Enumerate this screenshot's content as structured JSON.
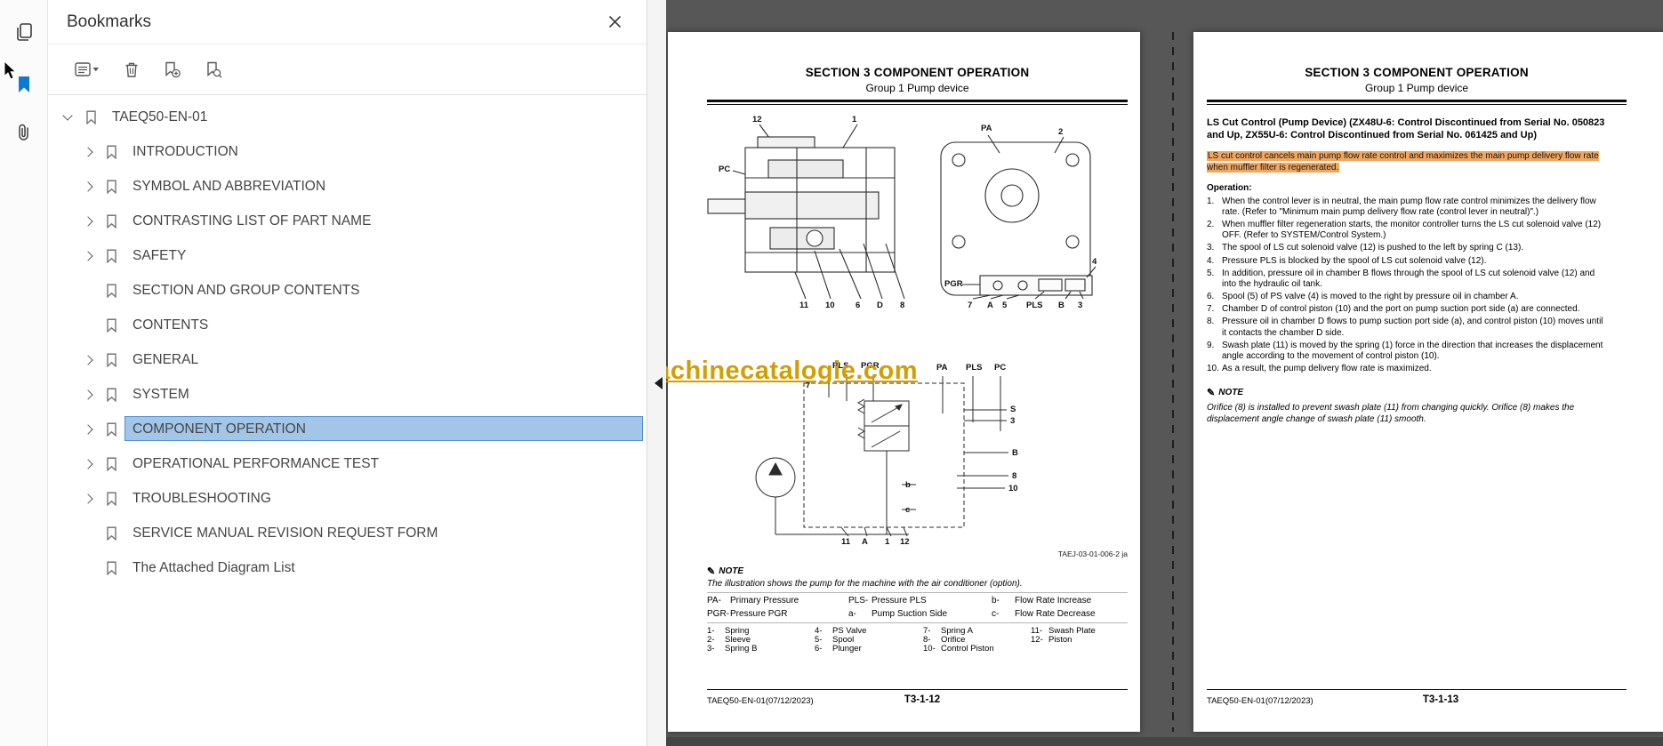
{
  "bookmarks": {
    "title": "Bookmarks",
    "tree": [
      {
        "label": "TAEQ50-EN-01"
      },
      {
        "label": "INTRODUCTION"
      },
      {
        "label": "SYMBOL AND ABBREVIATION"
      },
      {
        "label": "CONTRASTING LIST OF PART NAME"
      },
      {
        "label": "SAFETY"
      },
      {
        "label": "SECTION AND GROUP CONTENTS"
      },
      {
        "label": "CONTENTS"
      },
      {
        "label": "GENERAL"
      },
      {
        "label": "SYSTEM"
      },
      {
        "label": "COMPONENT OPERATION"
      },
      {
        "label": "OPERATIONAL PERFORMANCE TEST"
      },
      {
        "label": "TROUBLESHOOTING"
      },
      {
        "label": "SERVICE MANUAL REVISION REQUEST FORM"
      },
      {
        "label": "The Attached Diagram List"
      }
    ]
  },
  "page_header": {
    "title": "SECTION 3 COMPONENT OPERATION",
    "subtitle": "Group 1 Pump device"
  },
  "footer_left": "TAEQ50-EN-01(07/12/2023)",
  "watermark": "machinecatalogie.com",
  "left_page": {
    "d1_labels": [
      "12",
      "1",
      "PA",
      "2",
      "PC",
      "PGR",
      "11",
      "10",
      "6",
      "D",
      "8",
      "7",
      "A",
      "5",
      "PLS",
      "B",
      "3",
      "4"
    ],
    "d2_labels": [
      "7",
      "PLS",
      "PGR",
      "PA",
      "PLS",
      "PC",
      "S",
      "3",
      "B",
      "8",
      "10",
      "b",
      "c",
      "11",
      "A",
      "1",
      "12"
    ],
    "diagram_ref": "TAEJ-03-01-006-2 ja",
    "note_label": "NOTE",
    "note_text": "The illustration shows the pump for the machine with the air conditioner (option).",
    "legend": [
      {
        "code": "PA-",
        "name": "Primary Pressure"
      },
      {
        "code": "PGR-",
        "name": "Pressure PGR"
      },
      {
        "code": "PLS-",
        "name": "Pressure PLS"
      },
      {
        "code": "a-",
        "name": "Pump Suction Side"
      },
      {
        "code": "b-",
        "name": "Flow Rate Increase"
      },
      {
        "code": "c-",
        "name": "Flow Rate Decrease"
      }
    ],
    "parts": [
      {
        "no": "1-",
        "name": "Spring"
      },
      {
        "no": "2-",
        "name": "Sleeve"
      },
      {
        "no": "3-",
        "name": "Spring B"
      },
      {
        "no": "4-",
        "name": "PS Valve"
      },
      {
        "no": "5-",
        "name": "Spool"
      },
      {
        "no": "6-",
        "name": "Plunger"
      },
      {
        "no": "7-",
        "name": "Spring A"
      },
      {
        "no": "8-",
        "name": "Orifice"
      },
      {
        "no": "10-",
        "name": "Control Piston"
      },
      {
        "no": "11-",
        "name": "Swash Plate"
      },
      {
        "no": "12-",
        "name": "Piston"
      }
    ],
    "footer_page": "T3-1-12"
  },
  "right_page": {
    "section_title": "LS Cut Control (Pump Device) (ZX48U-6: Control Discontinued from Serial No. 050823 and Up, ZX55U-6: Control Discontinued from Serial No. 061425 and Up)",
    "intro": "LS cut control cancels main pump flow rate control and maximizes the main pump delivery flow rate when muffler filter is regenerated.",
    "operation_label": "Operation:",
    "steps": [
      {
        "n": "1.",
        "t": "When the control lever is in neutral, the main pump flow rate control minimizes the delivery flow rate. (Refer to \"Minimum main pump delivery flow rate (control lever in neutral)\".)"
      },
      {
        "n": "2.",
        "t": "When muffler filter regeneration starts, the monitor controller turns the LS cut solenoid valve (12) OFF. (Refer to SYSTEM/Control System.)"
      },
      {
        "n": "3.",
        "t": "The spool of LS cut solenoid valve (12) is pushed to the left by spring C (13)."
      },
      {
        "n": "4.",
        "t": "Pressure PLS is blocked by the spool of LS cut solenoid valve (12)."
      },
      {
        "n": "5.",
        "t": "In addition, pressure oil in chamber B flows through the spool of LS cut solenoid valve (12) and into the hydraulic oil tank."
      },
      {
        "n": "6.",
        "t": "Spool (5) of PS valve (4) is moved to the right by pressure oil in chamber A."
      },
      {
        "n": "7.",
        "t": "Chamber D of control piston (10) and the port on pump suction port side (a) are connected."
      },
      {
        "n": "8.",
        "t": "Pressure oil in chamber D flows to pump suction port side (a), and control piston (10) moves until it contacts the chamber D side."
      },
      {
        "n": "9.",
        "t": "Swash plate (11) is moved by the spring (1) force in the direction that increases the displacement angle according to the movement of control piston (10)."
      },
      {
        "n": "10.",
        "t": "As a result, the pump delivery flow rate is maximized."
      }
    ],
    "note_label": "NOTE",
    "note_text": "Orifice (8) is installed to prevent swash plate (11) from changing quickly. Orifice (8) makes the displacement angle change of swash plate (11) smooth.",
    "footer_page": "T3-1-13"
  }
}
